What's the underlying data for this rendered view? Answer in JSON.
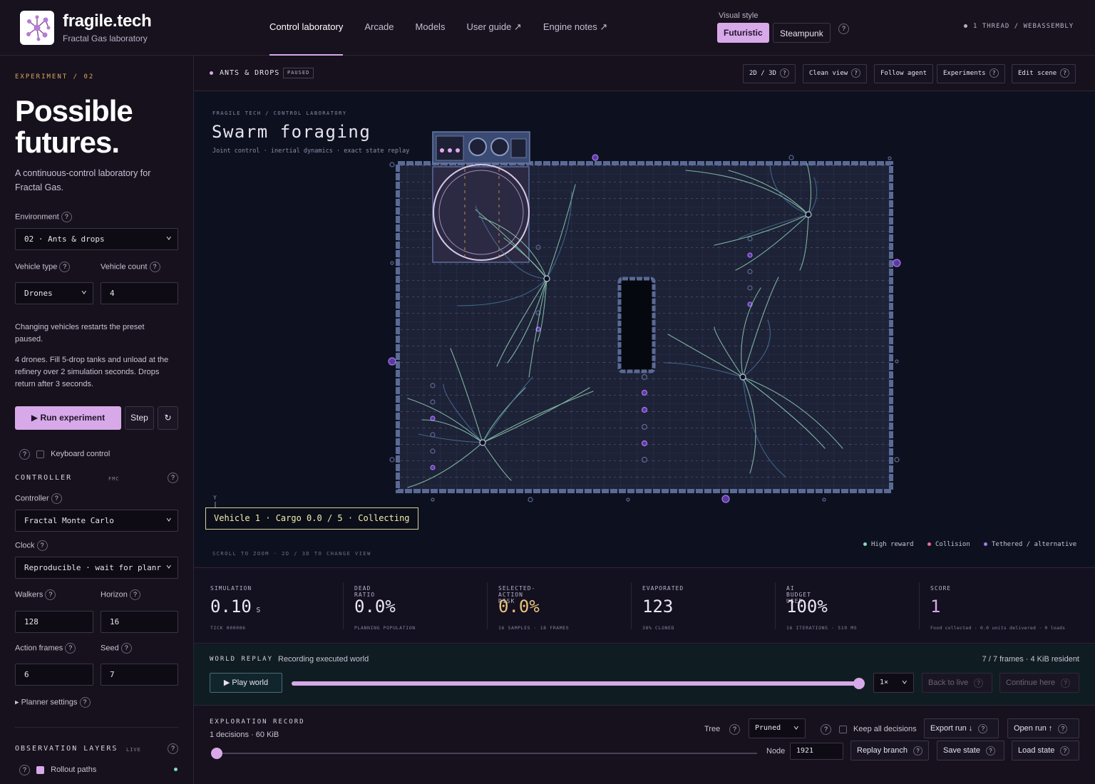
{
  "header": {
    "brand": "fragile.tech",
    "brand_sub": "Fractal Gas laboratory",
    "nav": [
      {
        "label": "Control laboratory"
      },
      {
        "label": "Arcade"
      },
      {
        "label": "Models"
      },
      {
        "label": "User guide ↗"
      },
      {
        "label": "Engine notes ↗"
      }
    ],
    "visual_style_label": "Visual style",
    "style_futuristic": "Futuristic",
    "style_steampunk": "Steampunk",
    "thread_status": "1 THREAD / WEBASSEMBLY",
    "help": "?"
  },
  "sidebar": {
    "kicker": "EXPERIMENT / 02",
    "hero_line1": "Possible",
    "hero_line2": "futures.",
    "lead": "A continuous-control laboratory for Fractal Gas.",
    "environment_label": "Environment",
    "environment_value": "02 · Ants & drops",
    "vehicle_type_label": "Vehicle type",
    "vehicle_type_value": "Drones",
    "vehicle_count_label": "Vehicle count",
    "vehicle_count_value": "4",
    "note1": "Changing vehicles restarts the preset paused.",
    "note2": "4 drones. Fill 5-drop tanks and unload at the refinery over 2 simulation seconds. Drops return after 3 seconds.",
    "run_label": "▶ Run experiment",
    "step_label": "Step",
    "reset_icon": "↻",
    "keyboard_label": "Keyboard control",
    "controller_section": "CONTROLLER",
    "controller_tag": "FMC",
    "controller_label": "Controller",
    "controller_value": "Fractal Monte Carlo",
    "clock_label": "Clock",
    "clock_value": "Reproducible · wait for planr",
    "walkers_label": "Walkers",
    "walkers_value": "128",
    "horizon_label": "Horizon",
    "horizon_value": "16",
    "action_frames_label": "Action frames",
    "action_frames_value": "6",
    "seed_label": "Seed",
    "seed_value": "7",
    "planner_settings": "▸ Planner settings",
    "obs_section": "OBSERVATION LAYERS",
    "obs_tag": "LIVE",
    "rollout_label": "Rollout paths"
  },
  "viewbar": {
    "scene_name": "ANTS & DROPS",
    "scene_state": "PAUSED",
    "btn_2d3d": "2D / 3D",
    "btn_clean": "Clean view",
    "btn_follow": "Follow agent",
    "btn_experiments": "Experiments",
    "btn_edit": "Edit scene"
  },
  "canvas": {
    "breadcrumb": "FRAGILE TECH / CONTROL LABORATORY",
    "title": "Swarm foraging",
    "subtitle": "Joint control · inertial dynamics · exact state replay",
    "axis_y": "Y",
    "vehicle_status": "Vehicle 1 · Cargo 0.0 / 5 · Collecting",
    "hint": "SCROLL TO ZOOM · 2D / 3D TO CHANGE VIEW",
    "legend_high": "High reward",
    "legend_collision": "Collision",
    "legend_tethered": "Tethered / alternative"
  },
  "stats": [
    {
      "key": "SIMULATION",
      "value": "0.10",
      "unit": "s",
      "sub": "TICK 000006"
    },
    {
      "key": "DEAD RATIO",
      "value": "0.0%",
      "unit": "",
      "sub": "PLANNING POPULATION"
    },
    {
      "key": "SELECTED-ACTION RISK",
      "value": "0.0%",
      "unit": "",
      "sub": "16 SAMPLES · 18 FRAMES"
    },
    {
      "key": "EVAPORATED",
      "value": "123",
      "unit": "",
      "sub": "38% CLONED"
    },
    {
      "key": "AI BUDGET USED",
      "value": "100%",
      "unit": "",
      "sub": "16 ITERATIONS · 519 MS"
    },
    {
      "key": "SCORE",
      "value": "1",
      "unit": "",
      "sub": "Food collected · 0.0 units delivered · 0 loads"
    }
  ],
  "replay": {
    "section": "WORLD REPLAY",
    "status": "Recording executed world",
    "frames": "7 / 7 frames · 4 KiB resident",
    "play_label": "▶ Play world",
    "speed_value": "1×",
    "back_label": "Back to live",
    "continue_label": "Continue here",
    "progress": 1.0
  },
  "explore": {
    "section": "EXPLORATION RECORD",
    "summary": "1 decisions · 60 KiB",
    "tree_label": "Tree",
    "tree_value": "Pruned",
    "keep_label": "Keep all decisions",
    "export_label": "Export run ↓",
    "open_label": "Open run ↑",
    "node_label": "Node",
    "node_value": "1921",
    "replay_branch": "Replay branch",
    "save_state": "Save state",
    "load_state": "Load state"
  },
  "colors": {
    "accent": "#d7a9e8",
    "kicker": "#d8a75f",
    "risk": "#e8c27a",
    "high_reward": "#7fe0b4",
    "collision": "#ef6b8f",
    "tethered": "#a878f0"
  }
}
